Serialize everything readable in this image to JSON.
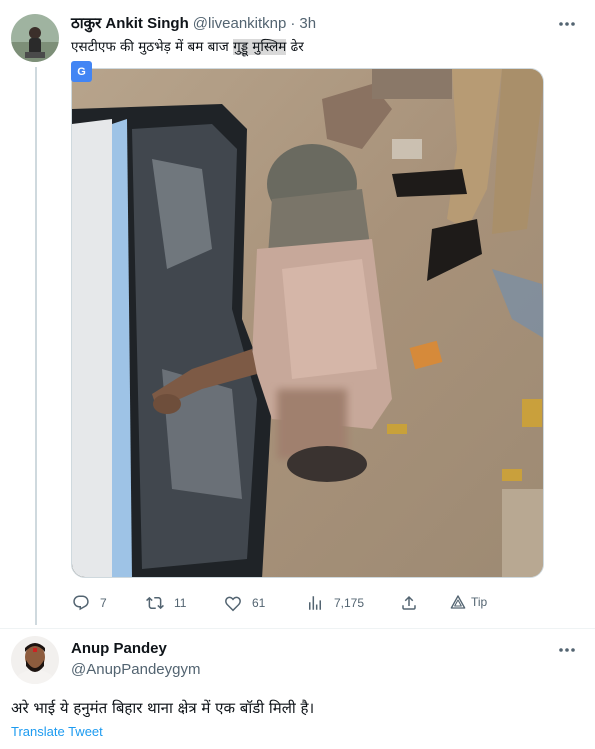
{
  "tweet": {
    "author_name": "ठाकुर Ankit Singh",
    "handle": "@liveankitknp",
    "separator": "·",
    "time": "3h",
    "text_before": "एसटीएफ की मुठभेड़ में बम बाज ",
    "text_highlight": "गुड्डू मुस्लिम",
    "text_after": " ढेर",
    "more_icon": "more-icon",
    "translate_badge_icon": "google-translate-icon",
    "translate_badge_text": "G",
    "actions": {
      "reply": {
        "icon": "reply-icon",
        "count": "7"
      },
      "retweet": {
        "icon": "retweet-icon",
        "count": "11"
      },
      "like": {
        "icon": "heart-icon",
        "count": "61"
      },
      "views": {
        "icon": "views-icon",
        "count": "7,175"
      },
      "share": {
        "icon": "share-icon"
      },
      "tip": {
        "icon": "tip-icon",
        "label": "Tip"
      }
    }
  },
  "reply": {
    "author_name": "Anup Pandey",
    "handle": "@AnupPandeygym",
    "more_icon": "more-icon",
    "text": "अरे भाई ये हनुमंत बिहार थाना क्षेत्र में एक बॉडी मिली है।",
    "translate_label": "Translate Tweet"
  },
  "colors": {
    "text_primary": "#0f1419",
    "text_secondary": "#536471",
    "link": "#1d9bf0",
    "border": "#cfd9de"
  }
}
